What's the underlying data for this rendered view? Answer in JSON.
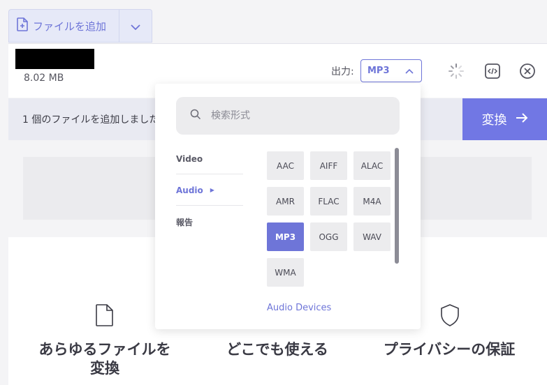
{
  "toolbar": {
    "add_file_label": "ファイルを追加"
  },
  "file": {
    "size": "8.02 MB"
  },
  "output": {
    "label": "出力:",
    "selected_format": "MP3"
  },
  "status": {
    "message": "1 個のファイルを追加しました"
  },
  "convert": {
    "label": "変換"
  },
  "features": [
    {
      "title_line1": "あらゆるファイルを",
      "title_line2": "変換",
      "icon": "file-icon"
    },
    {
      "title_line1": "どこでも使える",
      "icon": ""
    },
    {
      "title_line1": "プライバシーの保証",
      "icon": "shield-icon"
    }
  ],
  "dropdown": {
    "search_placeholder": "検索形式",
    "categories": [
      {
        "label": "Video",
        "active": false
      },
      {
        "label": "Audio",
        "active": true
      },
      {
        "label": "報告",
        "active": false
      }
    ],
    "formats": [
      "AAC",
      "AIFF",
      "ALAC",
      "AMR",
      "FLAC",
      "M4A",
      "MP3",
      "OGG",
      "WAV",
      "WMA"
    ],
    "selected": "MP3",
    "devices_label": "Audio Devices"
  },
  "colors": {
    "accent": "#6e75d8",
    "convert": "#7177e4"
  }
}
